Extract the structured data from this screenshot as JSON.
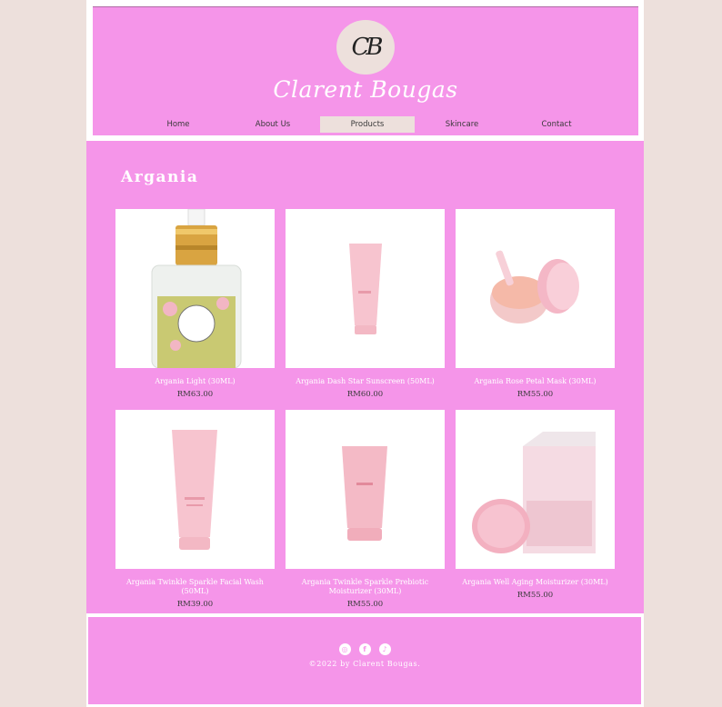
{
  "header": {
    "logo_text": "CB",
    "brand": "Clarent Bougas",
    "nav": [
      "Home",
      "About Us",
      "Products",
      "Skincare",
      "Contact"
    ],
    "active_nav": "Products"
  },
  "main": {
    "title": "Argania",
    "products": [
      {
        "name": "Argania Light (30ML)",
        "price": "RM63.00"
      },
      {
        "name": "Argania Dash Star Sunscreen (50ML)",
        "price": "RM60.00"
      },
      {
        "name": "Argania Rose Petal Mask (30ML)",
        "price": "RM55.00"
      },
      {
        "name": "Argania Twinkle Sparkle Facial Wash (50ML)",
        "price": "RM39.00"
      },
      {
        "name": "Argania Twinkle Sparkle Prebiotic Moisturizer (30ML)",
        "price": "RM55.00"
      },
      {
        "name": "Argania Well Aging Moisturizer (30ML)",
        "price": "RM55.00"
      }
    ]
  },
  "footer": {
    "social_icons": [
      "instagram-icon",
      "facebook-icon",
      "tiktok-icon"
    ],
    "copyright": "©2022 by Clarent Bougas."
  },
  "colors": {
    "page_bg": "#ede0dc",
    "accent_pink": "#f595e9",
    "text_dark": "#3a3a3a"
  }
}
